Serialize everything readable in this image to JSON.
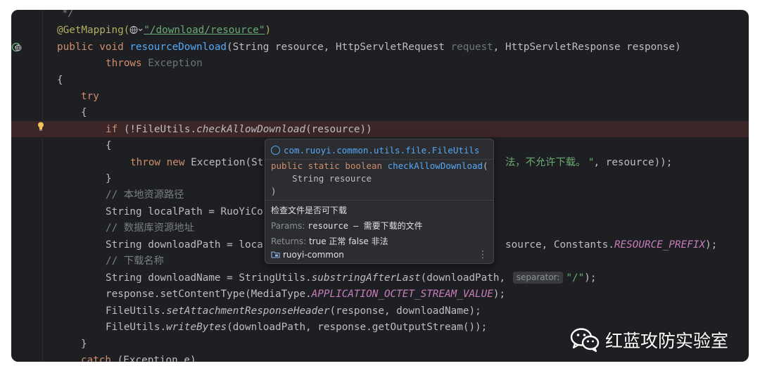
{
  "colors": {
    "background": "#1e1f22",
    "keyword": "#cf8e6d",
    "annotation": "#b3ae60",
    "method": "#56a8f5",
    "string": "#6aab73",
    "comment": "#7a7e85",
    "constant": "#c77dbb",
    "highlight_row": "#3d2628"
  },
  "code": {
    "l0": {
      "text": "*/"
    },
    "l1": {
      "ann": "@GetMapping(",
      "url": "\"/download/resource\"",
      "close": ")"
    },
    "l2": {
      "kw1": "public",
      "kw2": "void",
      "name": "resourceDownload",
      "p1": "(String resource, HttpServletRequest ",
      "p2": "request",
      "p3": ", HttpServletResponse response)"
    },
    "l3": {
      "kw": "throws",
      "ex": "Exception"
    },
    "l4": {
      "text": "{"
    },
    "l5": {
      "kw": "try"
    },
    "l6": {
      "text": "{"
    },
    "l7": {
      "kw": "if",
      "a": " (!FileUtils.",
      "m": "checkAllowDownload",
      "b": "(resource))"
    },
    "l8": {
      "text": "{"
    },
    "l9": {
      "kw1": "throw",
      "kw2": "new",
      "a": "Exception(St",
      "str": "法，不允许下载。 \"",
      "b": ", resource));"
    },
    "l10": {
      "text": "}"
    },
    "l11": {
      "text": "// 本地资源路径"
    },
    "l12": {
      "text": "String localPath = RuoYiCo"
    },
    "l13": {
      "text": "// 数据库资源地址"
    },
    "l14": {
      "a": "String downloadPath = loca",
      "b": "source, Constants.",
      "c": "RESOURCE_PREFIX",
      "d": ");"
    },
    "l15": {
      "text": "// 下载名称"
    },
    "l16": {
      "a": "String downloadName = StringUtils.",
      "m": "substringAfterLast",
      "b": "(downloadPath, ",
      "hint": "separator:",
      "s": "\"/\"",
      "c": ");"
    },
    "l17": {
      "a": "response.setContentType(MediaType.",
      "c": "APPLICATION_OCTET_STREAM_VALUE",
      "b": ");"
    },
    "l18": {
      "a": "FileUtils.",
      "m": "setAttachmentResponseHeader",
      "b": "(response, downloadName);"
    },
    "l19": {
      "a": "FileUtils.",
      "m": "writeBytes",
      "b": "(downloadPath, response.getOutputStream());"
    },
    "l20": {
      "text": "}"
    },
    "l21": {
      "kw": "catch",
      "a": " (Exception e)"
    }
  },
  "popup": {
    "qualified_name": "com.ruoyi.common.utils.file.FileUtils",
    "sig_kw": "public static boolean ",
    "sig_name": "checkAllowDownload",
    "sig_open": "(",
    "sig_param": "    String resource",
    "sig_close": ")",
    "description": "检查文件是否可下载",
    "params_label": "Params:",
    "params_value": "resource – 需要下载的文件",
    "returns_label": "Returns:",
    "returns_value": "true 正常 false 非法",
    "module": "ruoyi-common",
    "more": "⋮"
  },
  "watermark": {
    "text": "红蓝攻防实验室"
  }
}
